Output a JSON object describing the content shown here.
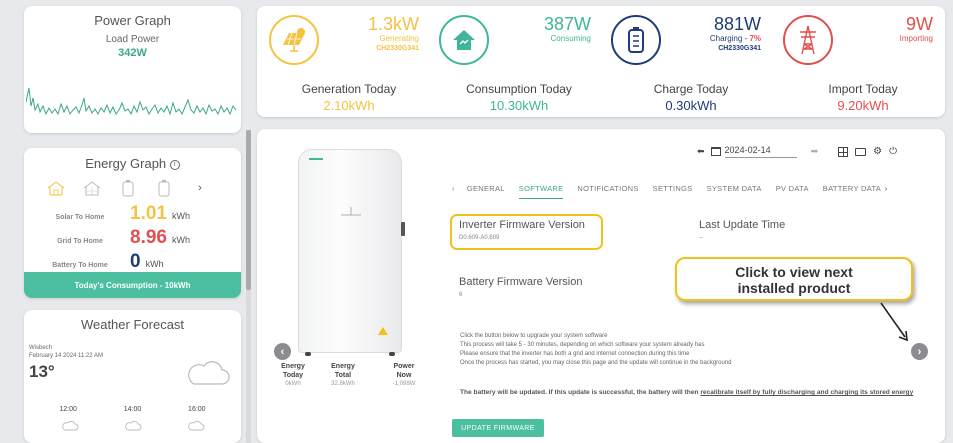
{
  "power_graph": {
    "title": "Power Graph",
    "subtitle": "Load Power",
    "value": "342W"
  },
  "energy_graph": {
    "title": "Energy Graph",
    "icons": [
      "solar-home-icon",
      "house-icon",
      "battery-icon",
      "battery-icon",
      "chevron-right-icon"
    ],
    "rows": [
      {
        "label": "Solar To Home",
        "value": "1.01",
        "unit": "kWh",
        "color": "#f5c242"
      },
      {
        "label": "Grid To Home",
        "value": "8.96",
        "unit": "kWh",
        "color": "#e34f4f"
      },
      {
        "label": "Battery To Home",
        "value": "0",
        "unit": "kWh",
        "color": "#1f3b78"
      }
    ],
    "footer": "Today's Consumption - 10kWh"
  },
  "weather": {
    "title": "Weather Forecast",
    "location": "Wisbech",
    "datetime": "February 14 2024 11:22 AM",
    "temperature": "13°",
    "times": [
      "12:00",
      "14:00",
      "16:00"
    ]
  },
  "stats": {
    "generating": {
      "value": "1.3kW",
      "label": "Generating",
      "id": "CH2330G341",
      "color": "#f5c242"
    },
    "consuming": {
      "value": "387W",
      "label": "Consuming",
      "color": "#3fb59a"
    },
    "charging": {
      "value": "881W",
      "label": "Charging - ",
      "percent": "7%",
      "id": "CH2330G341",
      "color": "#1f3b78"
    },
    "importing": {
      "value": "9W",
      "label": "Importing",
      "color": "#e34f4f"
    }
  },
  "today": [
    {
      "label": "Generation Today",
      "value": "2.10kWh",
      "color": "#f5c242"
    },
    {
      "label": "Consumption Today",
      "value": "10.30kWh",
      "color": "#3fb59a"
    },
    {
      "label": "Charge Today",
      "value": "0.30kWh",
      "color": "#1f3b78"
    },
    {
      "label": "Import Today",
      "value": "9.20kWh",
      "color": "#e34f4f"
    }
  ],
  "main": {
    "date": "2024-02-14",
    "tabs": [
      "GENERAL",
      "SOFTWARE",
      "NOTIFICATIONS",
      "SETTINGS",
      "SYSTEM DATA",
      "PV DATA",
      "BATTERY DATA"
    ],
    "active_tab": "SOFTWARE",
    "inverter_fw": {
      "label": "Inverter Firmware Version",
      "value": "D0.609-A0.609"
    },
    "last_update": {
      "label": "Last Update Time",
      "value": "--"
    },
    "battery_fw": {
      "label": "Battery Firmware Version",
      "value": "6"
    },
    "callout": {
      "line1": "Click to view next",
      "line2": "installed product"
    },
    "info_lines": [
      "Click the button below to upgrade your system software",
      "This process will take 5 - 30 minutes, depending on which software your system already has",
      "Please ensure that the inverter has both a grid and internet connection during this time",
      "Once the process has started, you may close this page and the update will continue in the background"
    ],
    "warning_pre": "The battery will be updated. If this update is successful, the battery will then ",
    "warning_link": "recalibrate itself by fully discharging and charging its stored energy",
    "update_button": "UPDATE FIRMWARE",
    "metrics": [
      {
        "label1": "Energy",
        "label2": "Today",
        "value": "0kWh"
      },
      {
        "label1": "Energy",
        "label2": "Total",
        "value": "32.8kWh"
      },
      {
        "label1": "Power",
        "label2": "Now",
        "value": "-1,098W"
      }
    ]
  },
  "colors": {
    "accent": "#4bbf9f",
    "highlight": "#f2c21b"
  }
}
